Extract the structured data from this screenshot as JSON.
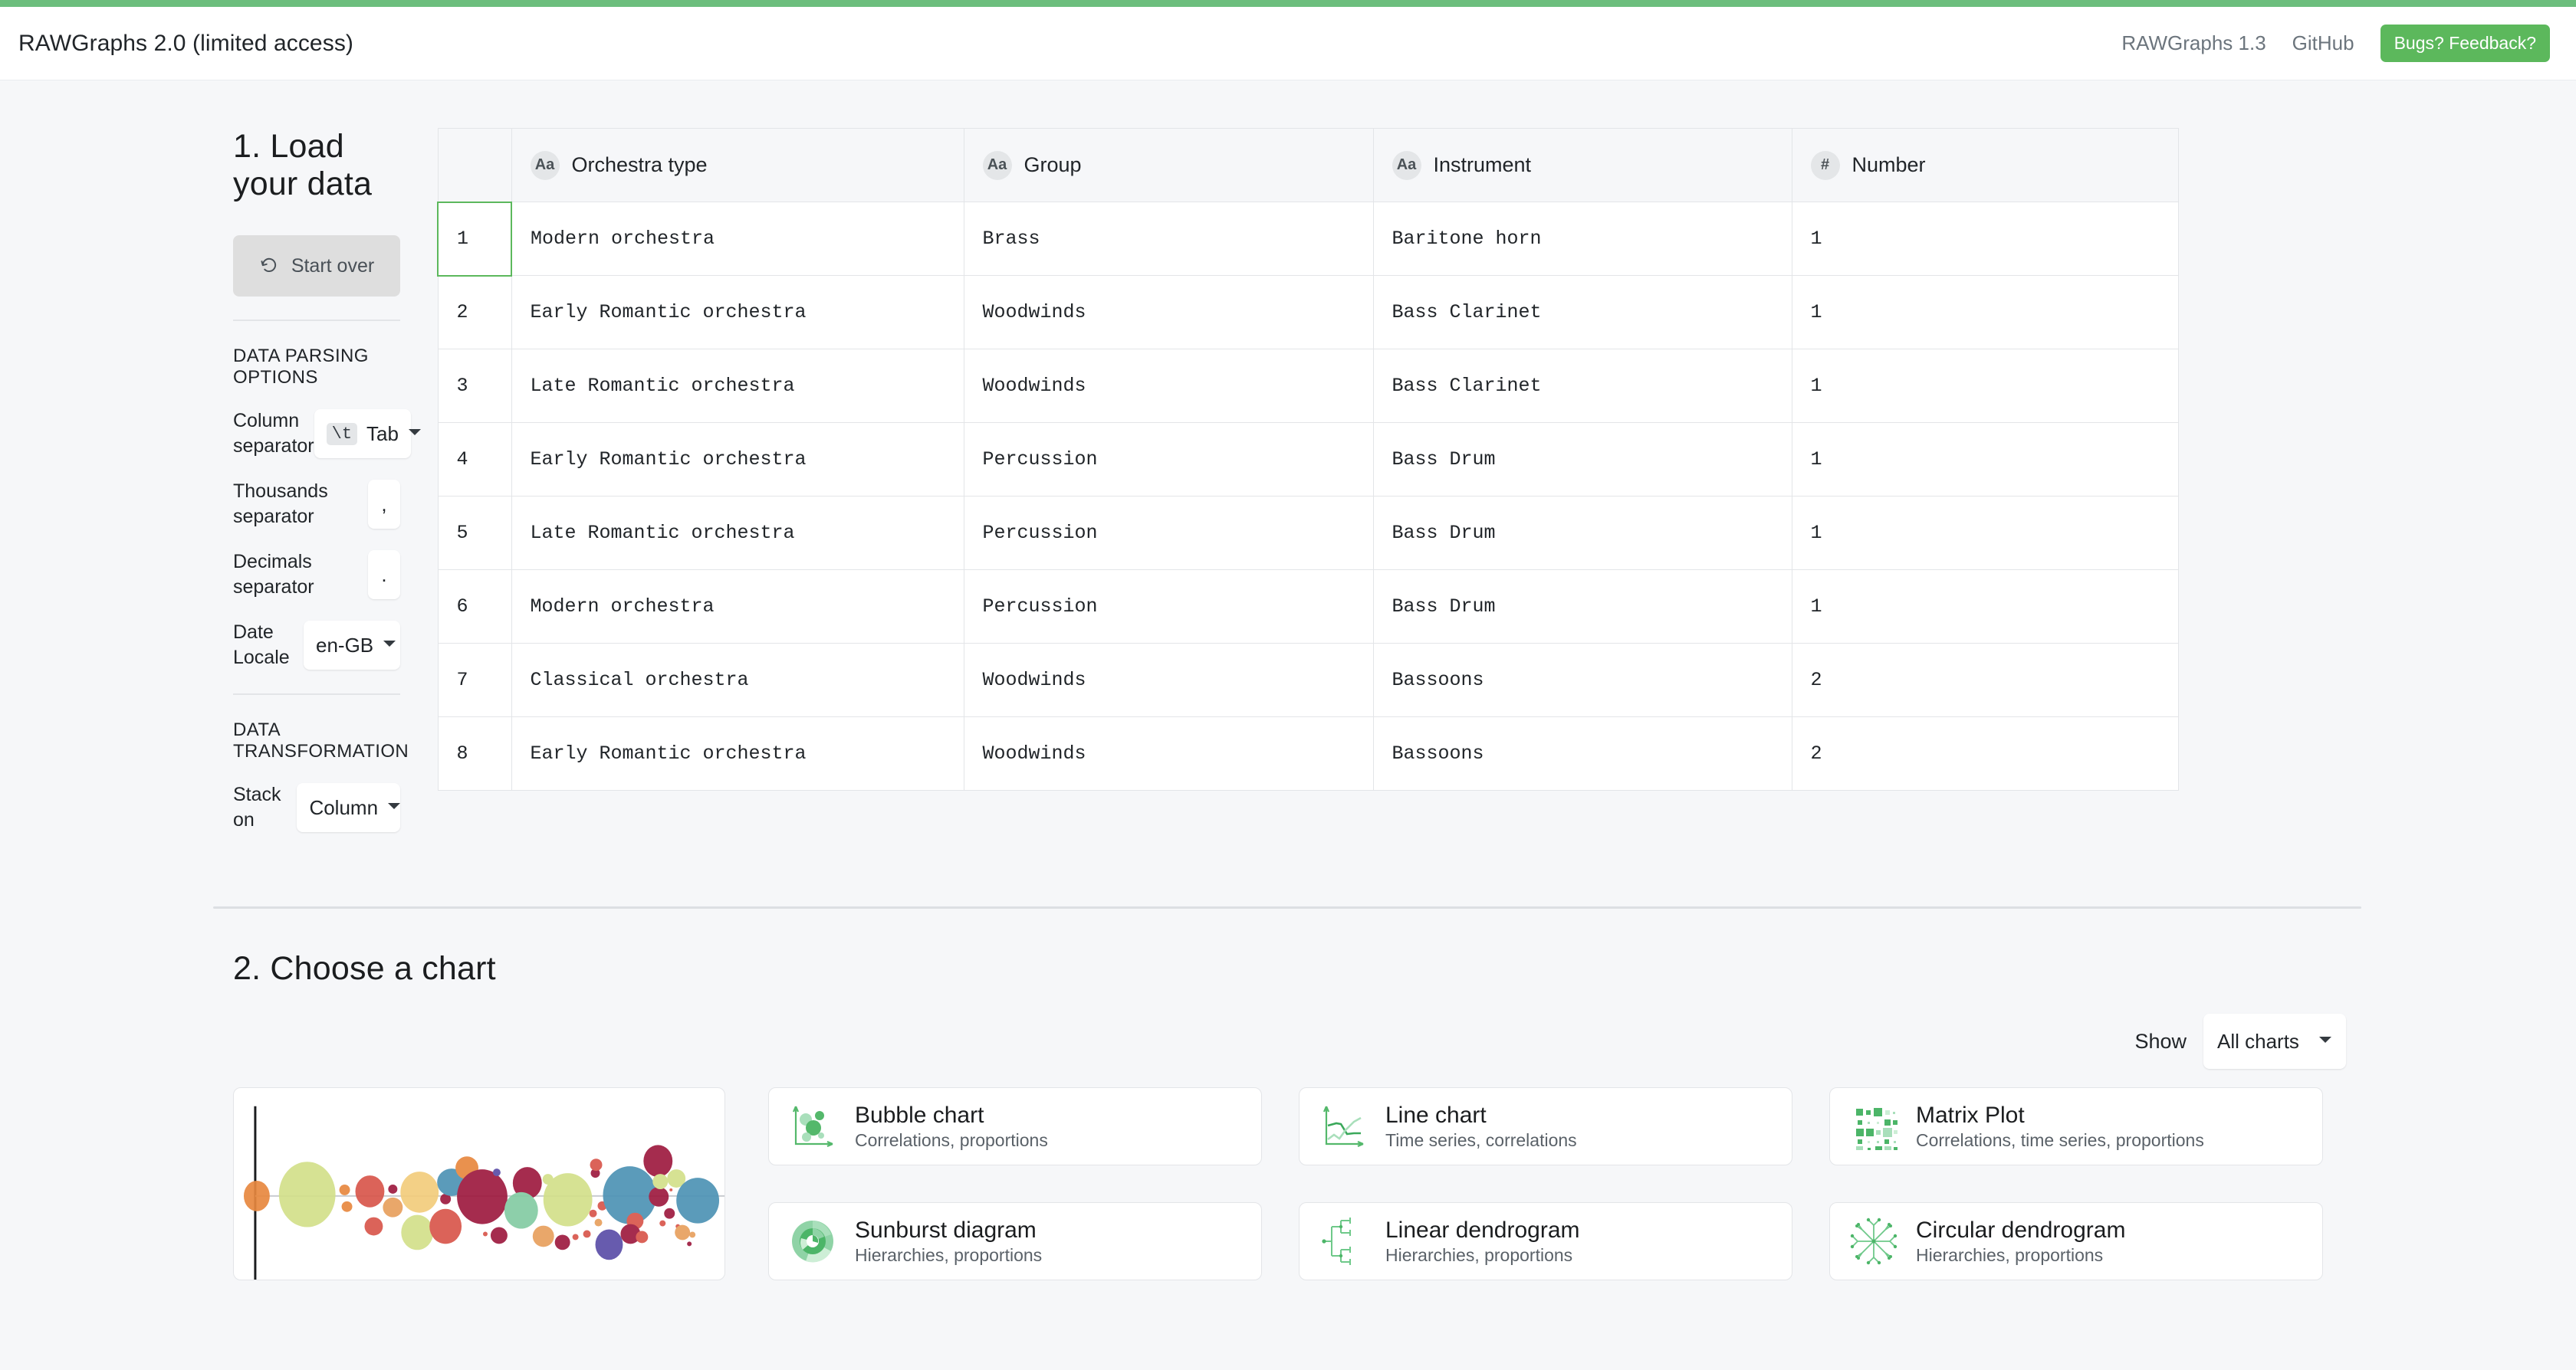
{
  "header": {
    "brand": "RAWGraphs 2.0 (limited access)",
    "links": [
      {
        "label": "RAWGraphs 1.3"
      },
      {
        "label": "GitHub"
      }
    ],
    "feedback_button": "Bugs? Feedback?",
    "accent_green": "#5cb85c",
    "topbar_green": "#6cbe7d"
  },
  "step1": {
    "title": "1. Load your data",
    "start_over": "Start over",
    "parsing_heading": "DATA PARSING OPTIONS",
    "column_separator": {
      "label": "Column separator",
      "chip": "\\t",
      "value": "Tab"
    },
    "thousands_separator": {
      "label": "Thousands separator",
      "value": ","
    },
    "decimals_separator": {
      "label": "Decimals separator",
      "value": "."
    },
    "date_locale": {
      "label": "Date Locale",
      "value": "en-GB"
    },
    "transformation_heading": "DATA TRANSFORMATION",
    "stack_on": {
      "label": "Stack on",
      "value": "Column"
    }
  },
  "table": {
    "columns": [
      {
        "badge": "Aa",
        "label": "Orchestra type"
      },
      {
        "badge": "Aa",
        "label": "Group"
      },
      {
        "badge": "Aa",
        "label": "Instrument"
      },
      {
        "badge": "#",
        "label": "Number"
      }
    ],
    "selected_row_index": 1,
    "rows": [
      {
        "n": "1",
        "cells": [
          "Modern orchestra",
          "Brass",
          "Baritone horn",
          "1"
        ]
      },
      {
        "n": "2",
        "cells": [
          "Early Romantic orchestra",
          "Woodwinds",
          "Bass Clarinet",
          "1"
        ]
      },
      {
        "n": "3",
        "cells": [
          "Late Romantic orchestra",
          "Woodwinds",
          "Bass Clarinet",
          "1"
        ]
      },
      {
        "n": "4",
        "cells": [
          "Early Romantic orchestra",
          "Percussion",
          "Bass Drum",
          "1"
        ]
      },
      {
        "n": "5",
        "cells": [
          "Late Romantic orchestra",
          "Percussion",
          "Bass Drum",
          "1"
        ]
      },
      {
        "n": "6",
        "cells": [
          "Modern orchestra",
          "Percussion",
          "Bass Drum",
          "1"
        ]
      },
      {
        "n": "7",
        "cells": [
          "Classical orchestra",
          "Woodwinds",
          "Bassoons",
          "2"
        ]
      },
      {
        "n": "8",
        "cells": [
          "Early Romantic orchestra",
          "Woodwinds",
          "Bassoons",
          "2"
        ]
      }
    ]
  },
  "step2": {
    "title": "2. Choose a chart",
    "show_label": "Show",
    "show_value": "All charts",
    "charts": [
      {
        "icon": "bubble-chart-icon",
        "name": "Bubble chart",
        "desc": "Correlations, proportions"
      },
      {
        "icon": "line-chart-icon",
        "name": "Line chart",
        "desc": "Time series, correlations"
      },
      {
        "icon": "matrix-plot-icon",
        "name": "Matrix Plot",
        "desc": "Correlations, time series, proportions"
      },
      {
        "icon": "sunburst-diagram-icon",
        "name": "Sunburst diagram",
        "desc": "Hierarchies, proportions"
      },
      {
        "icon": "linear-dendrogram-icon",
        "name": "Linear dendrogram",
        "desc": "Hierarchies, proportions"
      },
      {
        "icon": "circular-dendrogram-icon",
        "name": "Circular dendrogram",
        "desc": "Hierarchies, proportions"
      }
    ]
  }
}
